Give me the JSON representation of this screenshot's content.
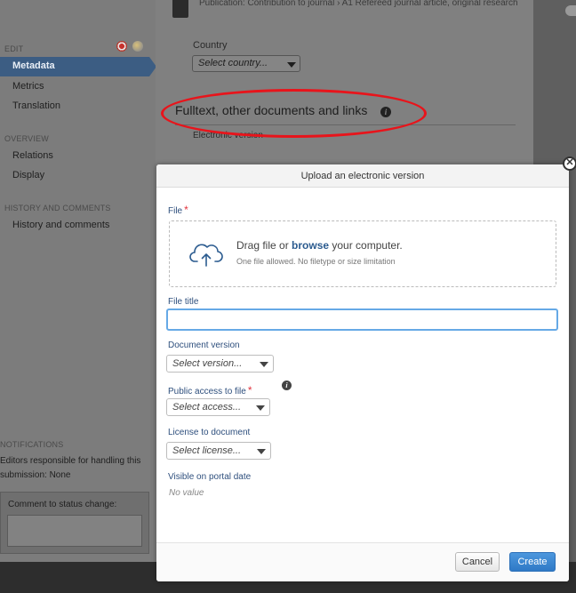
{
  "header": {
    "publication_text": "Publication: Contribution to journal › A1 Refereed journal article, original research"
  },
  "sidebar": {
    "edit_heading": "EDIT",
    "items_edit": [
      {
        "label": "Metadata",
        "active": true
      },
      {
        "label": "Metrics"
      },
      {
        "label": "Translation"
      }
    ],
    "overview_heading": "OVERVIEW",
    "items_overview": [
      {
        "label": "Relations"
      },
      {
        "label": "Display"
      }
    ],
    "history_heading": "HISTORY AND COMMENTS",
    "items_history": [
      {
        "label": "History and comments"
      }
    ],
    "notifications_heading": "NOTIFICATIONS",
    "notifications_text": "Editors responsible for handling this submission: None",
    "comment_label": "Comment to status change:",
    "flag_icons": [
      "uk-flag-icon",
      "globe-flag-icon"
    ]
  },
  "main": {
    "country_label": "Country",
    "country_placeholder": "Select country...",
    "section_title": "Fulltext, other documents and links",
    "electronic_version_label": "Electronic version"
  },
  "modal": {
    "title": "Upload an electronic version",
    "file_label": "File",
    "required_mark": "*",
    "drop_prefix": "Drag file or ",
    "drop_link": "browse",
    "drop_suffix": " your computer.",
    "drop_sub": "One file allowed. No filetype or size limitation",
    "file_title_label": "File title",
    "file_title_value": "",
    "doc_version_label": "Document version",
    "doc_version_placeholder": "Select version...",
    "public_access_label": "Public access to file",
    "public_access_placeholder": "Select access...",
    "license_label": "License to document",
    "license_placeholder": "Select license...",
    "visible_label": "Visible on portal date",
    "visible_value": "No value",
    "cancel_label": "Cancel",
    "create_label": "Create",
    "close_glyph": "✕"
  },
  "colors": {
    "accent": "#2f79c6",
    "label_blue": "#2e4f7d",
    "required_red": "#e2333d",
    "highlight_ellipse": "#e8141b",
    "sidebar_active": "#3c5d83"
  }
}
